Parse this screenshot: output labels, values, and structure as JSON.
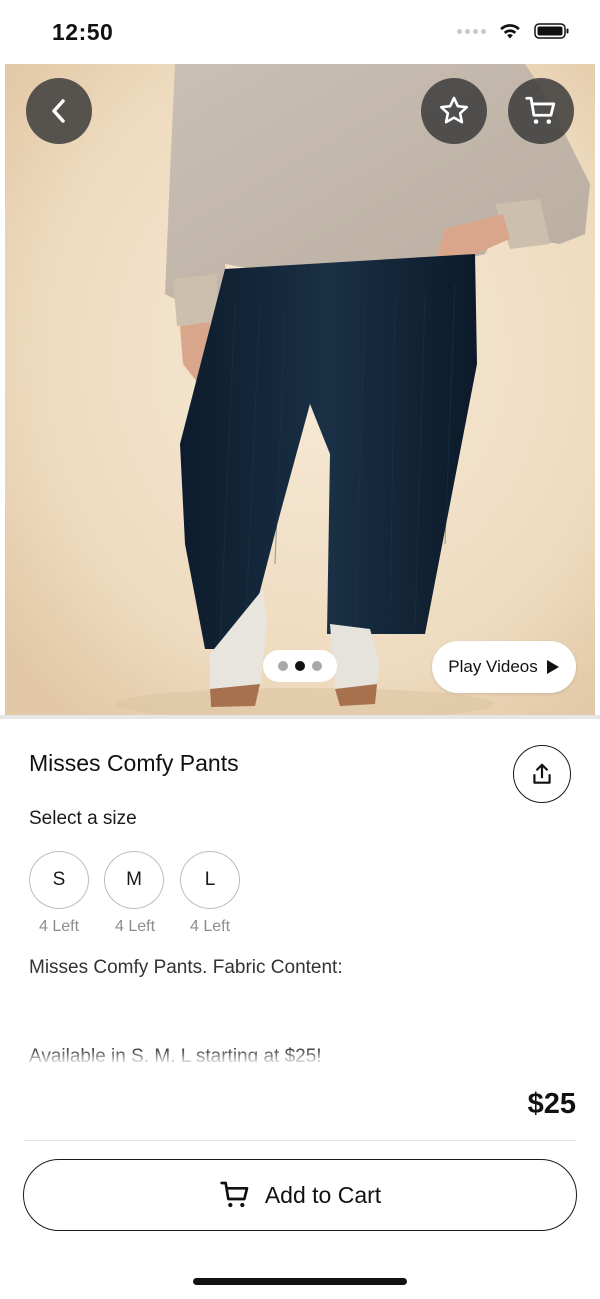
{
  "status_bar": {
    "time": "12:50"
  },
  "product": {
    "title": "Misses Comfy Pants",
    "price": "$25",
    "description_line1": "Misses Comfy Pants. Fabric Content:",
    "description_line2": "Available in S, M, L starting at $25!"
  },
  "image_pager": {
    "count": 3,
    "active_index": 1
  },
  "play_videos_label": "Play Videos",
  "size_section": {
    "heading": "Select a size",
    "sizes": [
      {
        "label": "S",
        "stock": "4 Left"
      },
      {
        "label": "M",
        "stock": "4 Left"
      },
      {
        "label": "L",
        "stock": "4 Left"
      }
    ]
  },
  "add_to_cart_label": "Add to Cart",
  "icons": {
    "back": "chevron-left-icon",
    "favorite": "star-icon",
    "cart": "cart-icon",
    "share": "share-icon",
    "play": "play-icon"
  },
  "colors": {
    "overlay_button": "#3c3c3c",
    "text": "#1a1a1a",
    "muted": "#8c8c8c",
    "accent": "#111111"
  }
}
